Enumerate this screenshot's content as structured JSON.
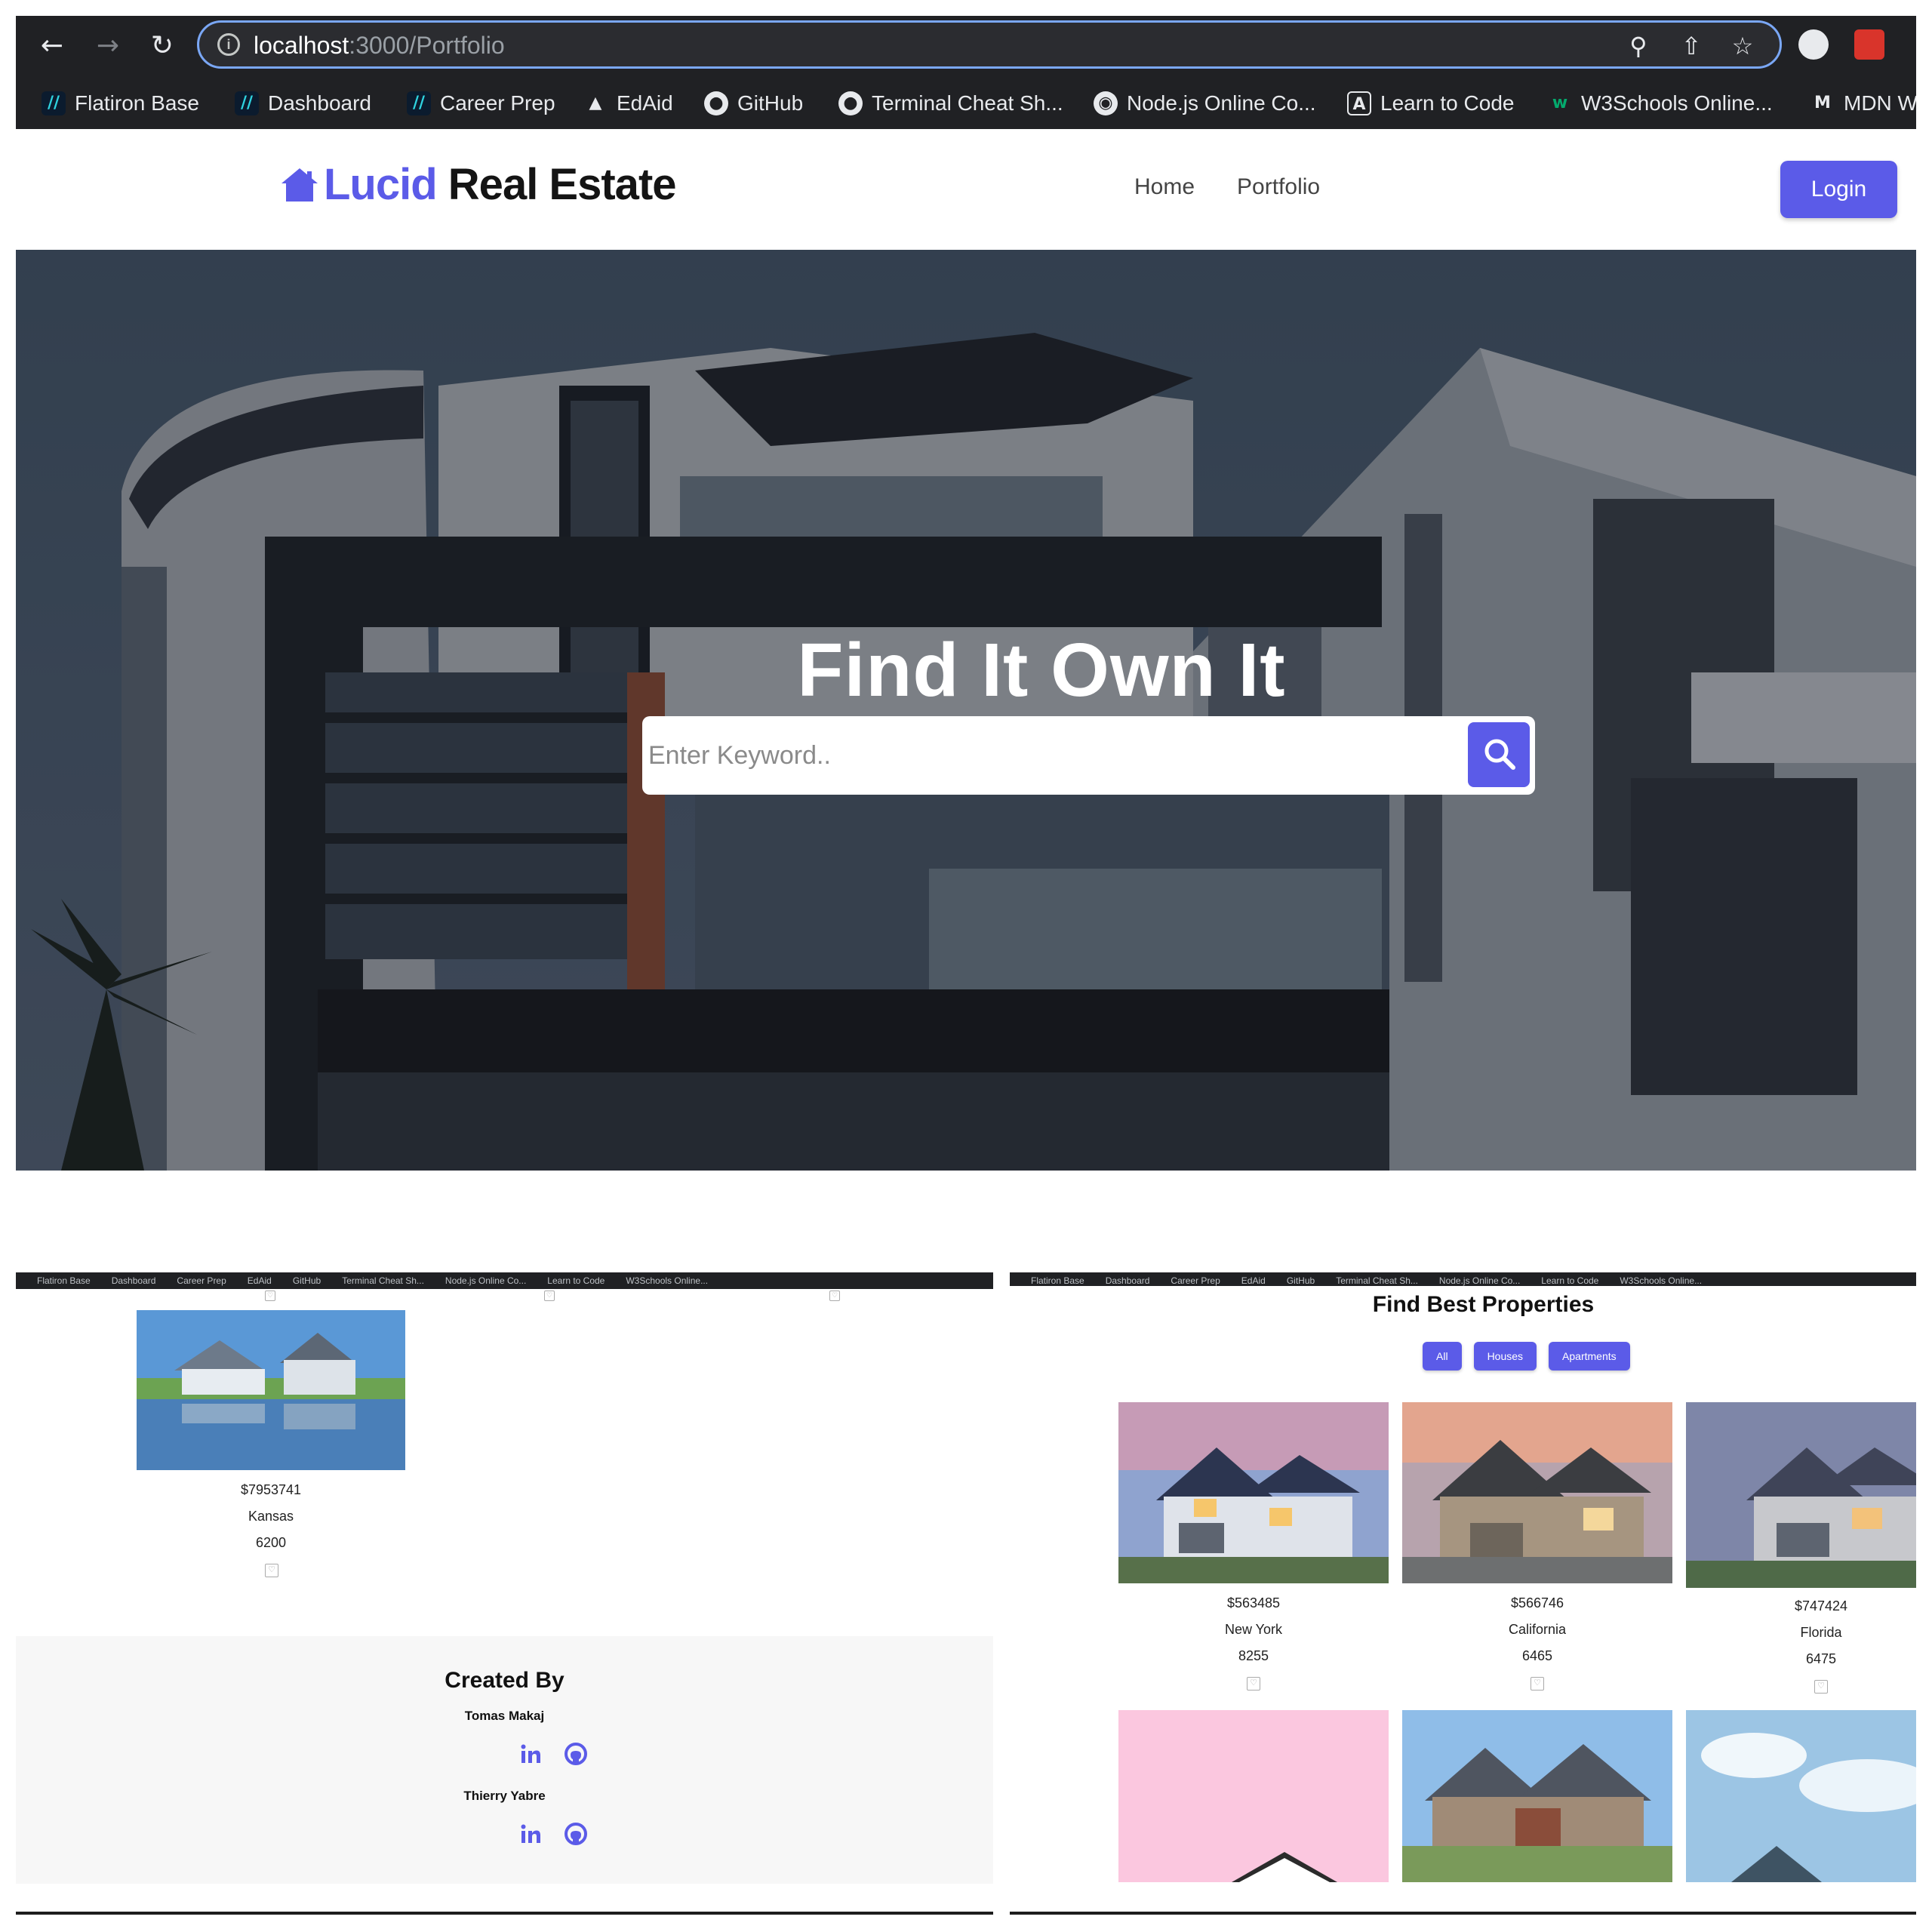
{
  "browser": {
    "url_host": "localhost",
    "url_path": ":3000/Portfolio",
    "bookmarks": [
      "Flatiron Base",
      "Dashboard",
      "Career Prep",
      "EdAid",
      "GitHub",
      "Terminal Cheat Sh...",
      "Node.js Online Co...",
      "Learn to Code",
      "W3Schools Online...",
      "MDN W"
    ]
  },
  "site": {
    "logo_lucid": "Lucid",
    "logo_rest": "Real Estate",
    "nav": [
      "Home",
      "Portfolio"
    ],
    "login_label": "Login",
    "accent": "#5b5be8"
  },
  "hero": {
    "title": "Find It Own It",
    "search_placeholder": "Enter Keyword.."
  },
  "left_panel": {
    "listing": {
      "price": "$7953741",
      "location": "Kansas",
      "size": "6200"
    },
    "footer": {
      "heading": "Created By",
      "authors": [
        "Tomas Makaj",
        "Thierry Yabre"
      ]
    }
  },
  "right_panel": {
    "heading": "Find Best Properties",
    "filters": [
      "All",
      "Houses",
      "Apartments"
    ],
    "listings": [
      {
        "price": "$563485",
        "location": "New York",
        "size": "8255"
      },
      {
        "price": "$566746",
        "location": "California",
        "size": "6465"
      },
      {
        "price": "$747424",
        "location": "Florida",
        "size": "6475"
      }
    ]
  }
}
